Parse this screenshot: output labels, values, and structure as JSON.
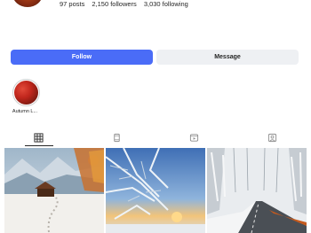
{
  "profile": {
    "stats": {
      "posts": "97 posts",
      "followers": "2,150 followers",
      "following": "3,030 following"
    }
  },
  "actions": {
    "follow_label": "Follow",
    "message_label": "Message"
  },
  "highlights": [
    {
      "label": "Autumn L..."
    }
  ],
  "tabs": [
    {
      "icon": "grid-icon",
      "active": true
    },
    {
      "icon": "reels-icon",
      "active": false
    },
    {
      "icon": "video-icon",
      "active": false
    },
    {
      "icon": "tagged-icon",
      "active": false
    }
  ],
  "posts": [
    {
      "icon": "snow-cabin-photo"
    },
    {
      "icon": "frosted-branches-sunset-photo"
    },
    {
      "icon": "snowy-forest-road-photo"
    }
  ],
  "colors": {
    "accent": "#4a6cf7",
    "secondary_button": "#eef0f3",
    "text": "#262626"
  }
}
